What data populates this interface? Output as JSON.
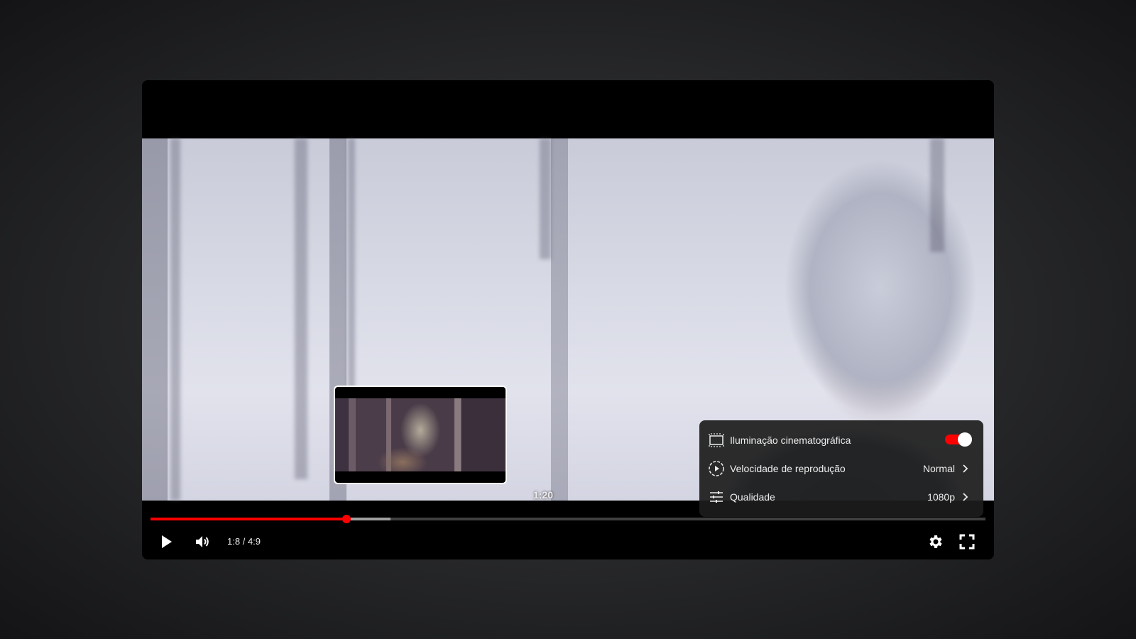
{
  "player": {
    "current_time": "1:8",
    "separator": "/",
    "duration": "4:9",
    "progress_fraction": 0.235,
    "buffered_fraction": 0.287
  },
  "preview": {
    "time": "1:20"
  },
  "settings_menu": {
    "items": [
      {
        "label": "Iluminação cinematográfica",
        "icon": "ambient-mode-icon",
        "toggle_on": true
      },
      {
        "label": "Velocidade de reprodução",
        "icon": "playback-speed-icon",
        "value": "Normal"
      },
      {
        "label": "Qualidade",
        "icon": "quality-icon",
        "value": "1080p"
      }
    ]
  },
  "colors": {
    "accent": "#ff0000",
    "menu_bg": "#1c1c1c"
  },
  "controls": {
    "play_icon": "play-icon",
    "volume_icon": "volume-icon",
    "settings_icon": "gear-icon",
    "fullscreen_icon": "fullscreen-icon"
  }
}
